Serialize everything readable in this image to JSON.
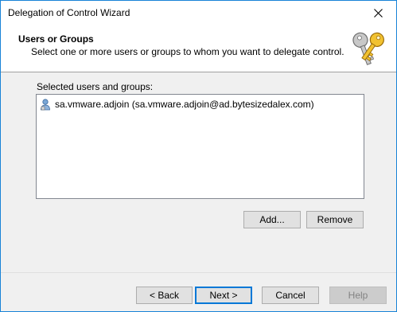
{
  "window": {
    "title": "Delegation of Control Wizard"
  },
  "header": {
    "title": "Users or Groups",
    "description": "Select one or more users or groups to whom you want to delegate control."
  },
  "selection": {
    "label": "Selected users and groups:",
    "items": [
      {
        "text": "sa.vmware.adjoin (sa.vmware.adjoin@ad.bytesizedalex.com)",
        "icon": "user-icon"
      }
    ]
  },
  "buttons": {
    "add": "Add...",
    "remove": "Remove",
    "back": "< Back",
    "next": "Next >",
    "cancel": "Cancel",
    "help": "Help"
  },
  "colors": {
    "accent": "#0078d7",
    "window_border": "#1883d7"
  }
}
